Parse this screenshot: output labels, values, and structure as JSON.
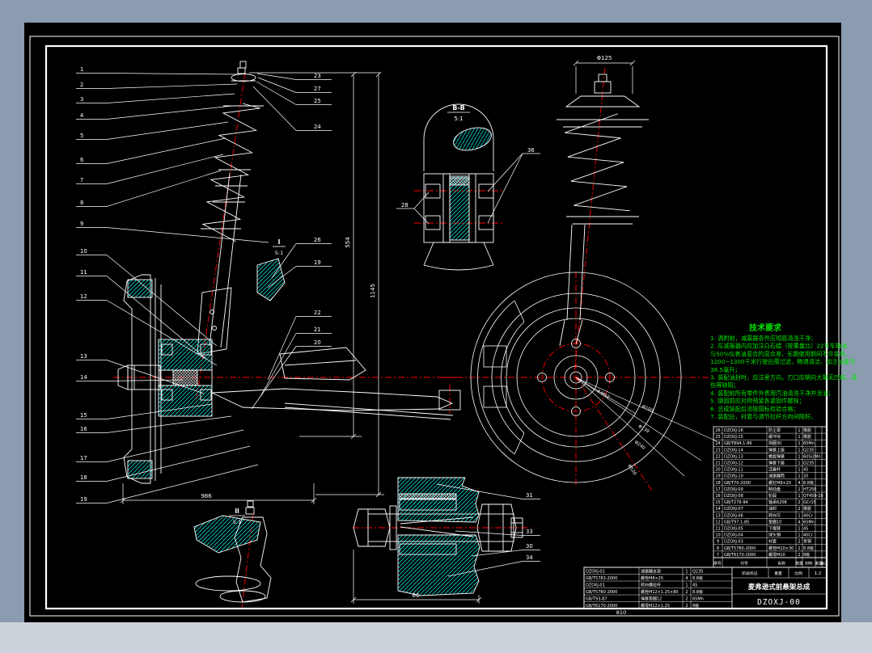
{
  "drawing_no": "DZOXJ-00",
  "colors": {
    "bezel_top": "#8b9cb1",
    "bezel_bottom": "#ccd2d9",
    "canvas": "#000000",
    "line": "#ffffff",
    "hatch": "#00dede",
    "centerline": "#ff0000",
    "notes_green": "#00e400"
  },
  "sections": {
    "bb": {
      "label": "B-B",
      "scale": "5:1"
    },
    "i": {
      "label": "I",
      "scale": "5:1"
    },
    "ii": {
      "label": "II",
      "scale": "5:1"
    }
  },
  "dimensions": {
    "strut_top_dia": "Φ125",
    "overall_554": "554",
    "overall_1145": "1145",
    "width_986": "986",
    "bolt_66": "66",
    "frame_810": "810"
  },
  "disc_labels": [
    "4-M12",
    "Φ100",
    "Φ139",
    "Φ240",
    "Φ520"
  ],
  "balloons": {
    "left": [
      "1",
      "2",
      "3",
      "4",
      "5",
      "6",
      "7",
      "8",
      "9",
      "10",
      "11",
      "12",
      "13",
      "14",
      "15",
      "16",
      "17",
      "18",
      "19"
    ],
    "top_right": [
      "23",
      "27",
      "25",
      "24"
    ],
    "mid_right": [
      "26",
      "19"
    ],
    "lower_right": [
      "22",
      "21",
      "20"
    ],
    "section_bb": [
      "28",
      "36"
    ],
    "bolt_detail": [
      "31",
      "33",
      "30",
      "34"
    ]
  },
  "notes": {
    "title": "技术要求",
    "lines": [
      "1. 调附前，减震器各件应彻底清洗干净；",
      "2. 在减振器内应加注白石蜡（按重量比）22号车轴油",
      "与50%仪表油混合的混合液，长期使用期间不许变质，",
      "1200~1300千米行驶后需过滤，畅通清洁，加注油量为",
      "38.5毫升；",
      "3. 装配油封时，应注意方向。刃口应朝向大端无凹痕、碰",
      "伤等缺陷；",
      "4. 装配前所有零件外表用汽油清洗干净并涂油；",
      "5. 铆固前应对称预紧各紧固件螺栓；",
      "6. 总成装配后须按国标检验合格；",
      "7. 装配后，衬套与调节拉杆方向间隙好。"
    ]
  },
  "bom": {
    "headers": [
      "序号",
      "代号",
      "名称",
      "数量",
      "材料",
      "重量",
      "备注"
    ],
    "rows": [
      [
        "26",
        "DZOXJ-16",
        "防尘罩",
        "1",
        "橡胶"
      ],
      [
        "25",
        "DZOXJ-15",
        "缓冲块",
        "1",
        "橡胶"
      ],
      [
        "24",
        "GB/T894.1-86",
        "挡圈30",
        "1",
        "65Mn"
      ],
      [
        "23",
        "DZOXJ-14",
        "弹簧上座",
        "1",
        "Q235"
      ],
      [
        "22",
        "DZOXJ-13",
        "螺旋弹簧",
        "1",
        "60Si2Mn"
      ],
      [
        "21",
        "DZOXJ-12",
        "弹簧下座",
        "1",
        "Q235"
      ],
      [
        "20",
        "DZOXJ-11",
        "活塞杆",
        "1",
        "45"
      ],
      [
        "19",
        "DZOXJ-10",
        "减振器筒",
        "1",
        "20"
      ],
      [
        "18",
        "GB/T70-2000",
        "螺钉M8×20",
        "4",
        "8.8级"
      ],
      [
        "17",
        "DZOXJ-09",
        "制动盘",
        "1",
        "HT250"
      ],
      [
        "16",
        "DZOXJ-08",
        "轮毂",
        "1",
        "QT450-10"
      ],
      [
        "15",
        "GB/T276-94",
        "轴承6208",
        "2",
        "GCr15"
      ],
      [
        "14",
        "DZOXJ-07",
        "油封",
        "2",
        "橡胶"
      ],
      [
        "13",
        "DZOXJ-06",
        "转向节",
        "1",
        "40Cr"
      ],
      [
        "12",
        "GB/T97.1-85",
        "垫圈10",
        "4",
        "65Mn"
      ],
      [
        "11",
        "DZOXJ-05",
        "下摆臂",
        "1",
        "45"
      ],
      [
        "10",
        "DZOXJ-04",
        "球头销",
        "1",
        "40Cr"
      ],
      [
        "9",
        "DZOXJ-03",
        "衬套",
        "2",
        "青铜"
      ],
      [
        "8",
        "GB/T5780-2000",
        "螺栓M10×30",
        "2",
        "8.8级"
      ],
      [
        "7",
        "GB/T6170-2000",
        "螺母M10",
        "2",
        "8级"
      ]
    ],
    "extra_rows": [
      [
        "DZOXJ-02",
        "减振器支架",
        "1",
        "Q235"
      ],
      [
        "GB/T5783-2000",
        "螺栓M8×25",
        "4",
        "8.8级"
      ],
      [
        "DZOXJ-01",
        "转向横拉杆",
        "1",
        "45"
      ],
      [
        "GB/T5780-2000",
        "螺栓M12×1.25×80",
        "2",
        "8.8级"
      ],
      [
        "GB/T93-87",
        "弹簧垫圈12",
        "2",
        "65Mn"
      ],
      [
        "GB/T6170-2000",
        "螺母M12×1.25",
        "2",
        "8级"
      ]
    ]
  },
  "titleblock": {
    "stage_label": "阶段标记",
    "weight_label": "重量",
    "scale_label": "比例",
    "scale_value": "1:2",
    "title": "麦弗逊式前悬架总成",
    "drawing_no": "DZOXJ-00"
  }
}
